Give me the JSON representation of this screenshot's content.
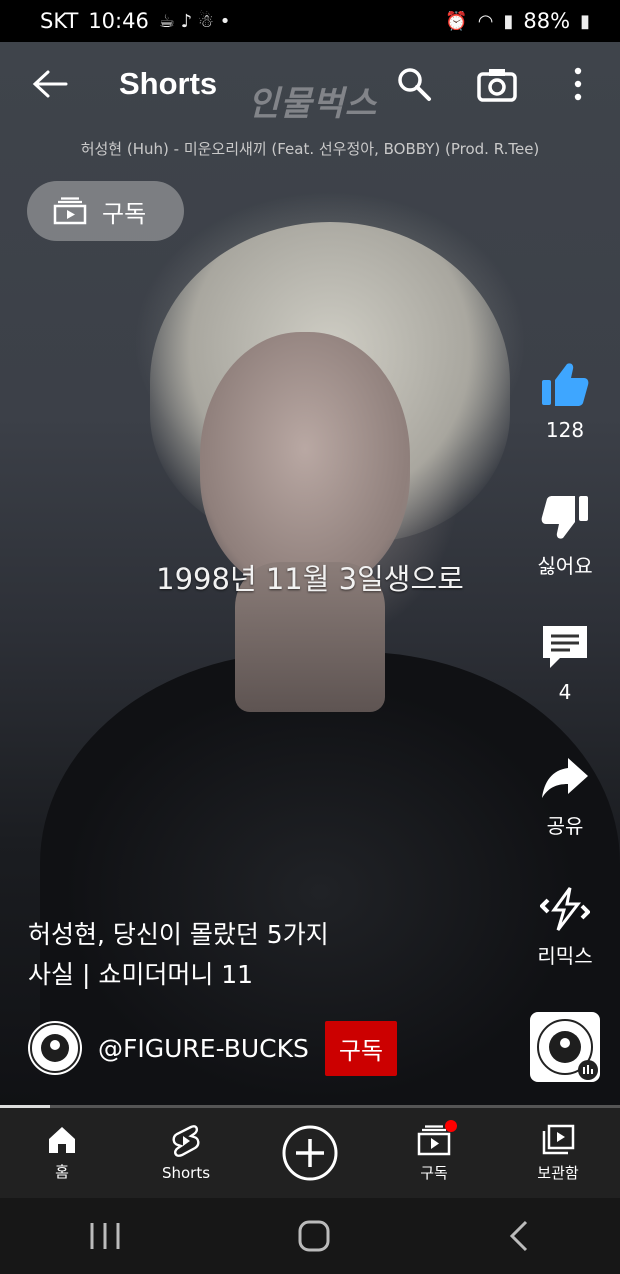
{
  "status_bar": {
    "carrier": "SKT",
    "time": "10:46",
    "battery": "88%"
  },
  "app_bar": {
    "title": "Shorts",
    "watermark": "인물벅스",
    "icons": [
      "back-arrow-icon",
      "search-icon",
      "camera-icon",
      "more-vert-icon"
    ]
  },
  "video": {
    "song": "허성현 (Huh) - 미운오리새끼 (Feat. 선우정아, BOBBY) (Prod. R.Tee)",
    "subscriptions_chip": "구독",
    "mid_caption": "1998년 11월 3일생으로",
    "title_line1": "허성현, 당신이 몰랐던 5가지",
    "title_line2": "사실 | 쇼미더머니 11",
    "channel_handle": "@FIGURE-BUCKS",
    "subscribe_label": "구독",
    "progress_fraction": 0.08
  },
  "actions": {
    "like_count": "128",
    "dislike_label": "싫어요",
    "comment_count": "4",
    "share_label": "공유",
    "remix_label": "리믹스"
  },
  "bottom_nav": {
    "items": [
      {
        "label": "홈",
        "icon": "home-icon"
      },
      {
        "label": "Shorts",
        "icon": "shorts-icon"
      },
      {
        "label": "",
        "icon": "create-plus-icon"
      },
      {
        "label": "구독",
        "icon": "subscriptions-icon"
      },
      {
        "label": "보관함",
        "icon": "library-icon"
      }
    ]
  },
  "colors": {
    "subscribe_red": "#cc0000",
    "like_blue": "#3ea6ff",
    "nav_bg": "#212121"
  }
}
